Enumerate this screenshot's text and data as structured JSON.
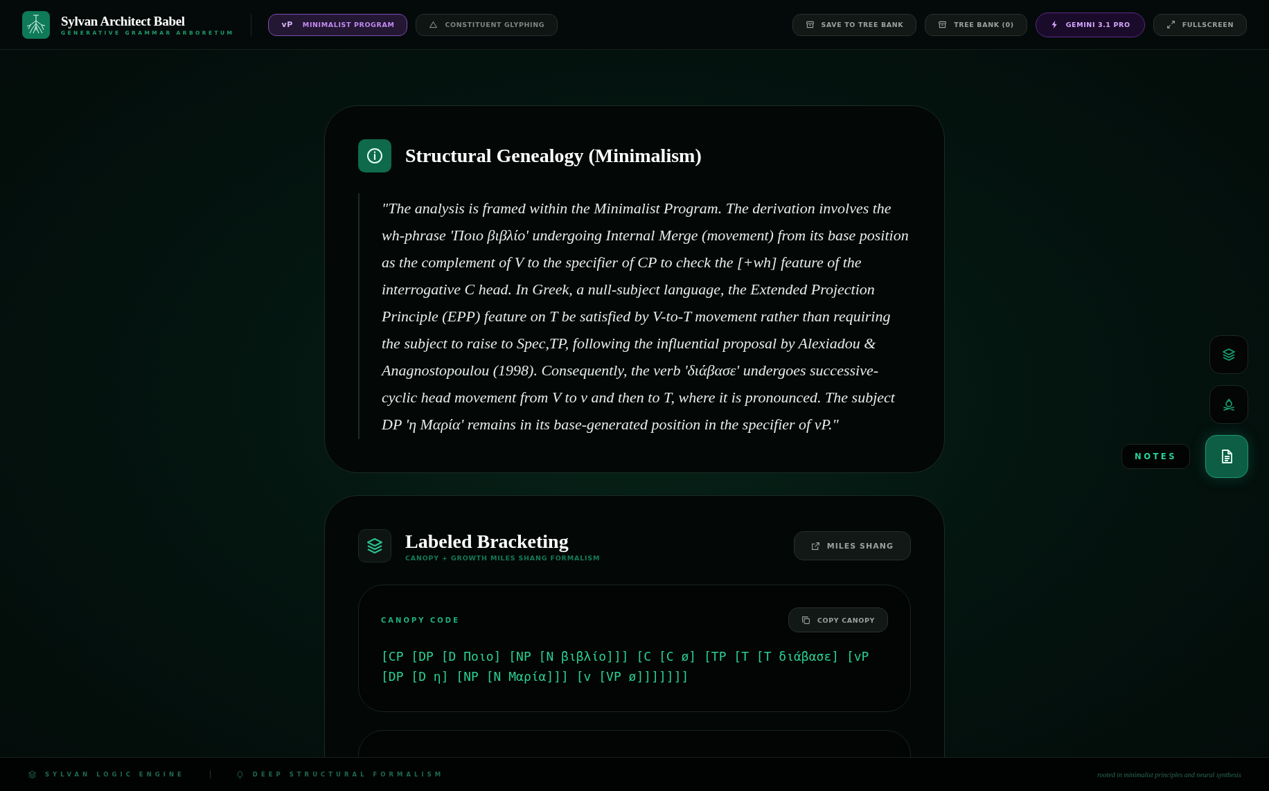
{
  "header": {
    "title": "Sylvan Architect Babel",
    "subtitle": "GENERATIVE GRAMMAR ARBORETUM",
    "modes": [
      {
        "prefix": "vP",
        "label": "MINIMALIST PROGRAM",
        "selected": true
      },
      {
        "label": "CONSTITUENT GLYPHING",
        "selected": false
      }
    ],
    "actions": [
      {
        "kind": "action",
        "label": "SAVE TO TREE BANK"
      },
      {
        "kind": "action",
        "label": "TREE BANK (0)"
      },
      {
        "kind": "model",
        "label": "GEMINI 3.1 PRO"
      },
      {
        "kind": "action",
        "label": "FULLSCREEN"
      }
    ]
  },
  "genealogy": {
    "title": "Structural Genealogy (Minimalism)",
    "text": "\"The analysis is framed within the Minimalist Program. The derivation involves the wh-phrase 'Ποιο βιβλίο' undergoing Internal Merge (movement) from its base position as the complement of V to the specifier of CP to check the [+wh] feature of the interrogative C head. In Greek, a null-subject language, the Extended Projection Principle (EPP) feature on T be satisfied by V-to-T movement rather than requiring the subject to raise to Spec,TP, following the influential proposal by Alexiadou & Anagnostopoulou (1998). Consequently, the verb 'διάβασε' undergoes successive-cyclic head movement from V to v and then to T, where it is pronounced. The subject DP 'η Μαρία' remains in its base-generated position in the specifier of vP.\""
  },
  "bracketing": {
    "title": "Labeled Bracketing",
    "subtitle": "CANOPY + GROWTH MILES SHANG FORMALISM",
    "link_button": "MILES SHANG",
    "canopy": {
      "label": "CANOPY CODE",
      "copy_button": "COPY CANOPY",
      "code": "[CP [DP [D Ποιο] [NP [N βιβλίο]]] [C [C ø] [TP [T [T διάβασε] [vP [DP [D η] [NP [N Μαρία]]] [v [VP ø]]]]]]]"
    }
  },
  "side_rail": {
    "items": [
      {
        "selected": false
      },
      {
        "selected": false
      },
      {
        "selected": true
      }
    ],
    "tooltip": "NOTES"
  },
  "footer": {
    "items": [
      {
        "label": "SYLVAN LOGIC ENGINE"
      },
      {
        "label": "DEEP STRUCTURAL FORMALISM"
      }
    ],
    "tagline": "rooted in minimalist principles and neural synthesis"
  }
}
